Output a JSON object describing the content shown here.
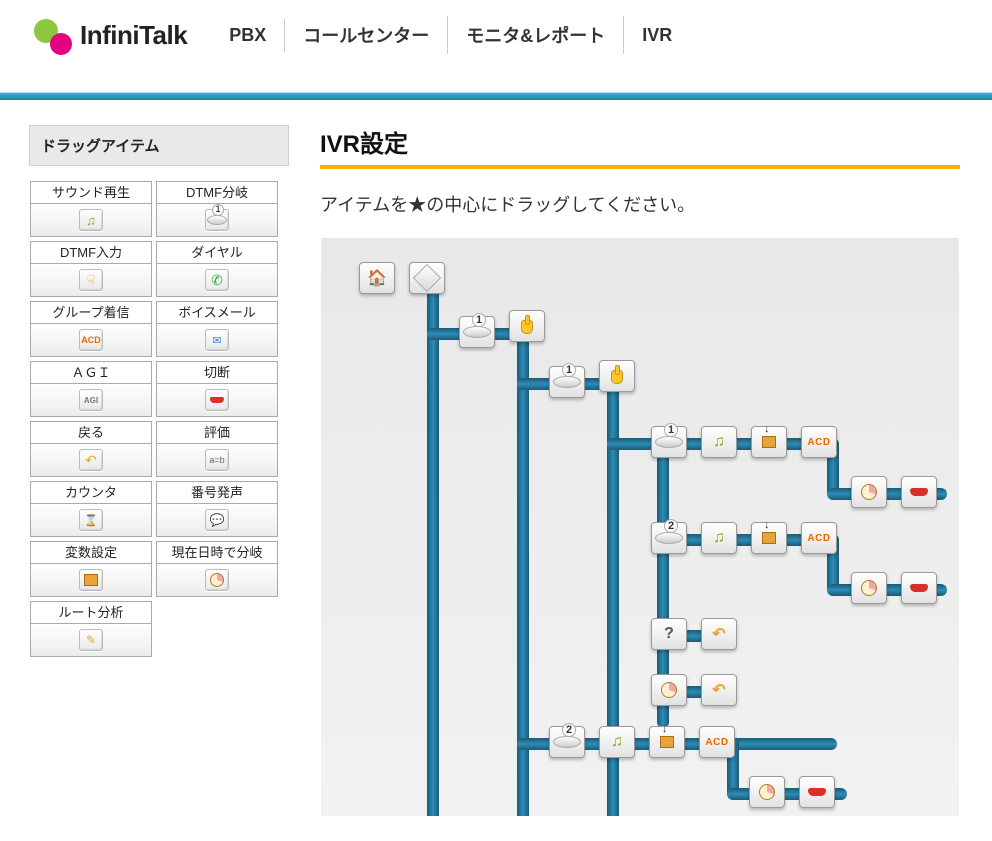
{
  "brand": {
    "name": "InfiniTalk"
  },
  "nav": {
    "pbx": "PBX",
    "callcenter": "コールセンター",
    "monitor": "モニタ&レポート",
    "ivr": "IVR"
  },
  "sidebar": {
    "title": "ドラッグアイテム",
    "items": [
      {
        "label": "サウンド再生",
        "icon": "music"
      },
      {
        "label": "DTMF分岐",
        "icon": "disc"
      },
      {
        "label": "DTMF入力",
        "icon": "hand"
      },
      {
        "label": "ダイヤル",
        "icon": "dial"
      },
      {
        "label": "グループ着信",
        "icon": "acd"
      },
      {
        "label": "ボイスメール",
        "icon": "mail"
      },
      {
        "label": "ＡＧＩ",
        "icon": "agi"
      },
      {
        "label": "切断",
        "icon": "hang"
      },
      {
        "label": "戻る",
        "icon": "back"
      },
      {
        "label": "評価",
        "icon": "eval"
      },
      {
        "label": "カウンタ",
        "icon": "counter"
      },
      {
        "label": "番号発声",
        "icon": "speak"
      },
      {
        "label": "変数設定",
        "icon": "varset"
      },
      {
        "label": "現在日時で分岐",
        "icon": "clock"
      },
      {
        "label": "ルート分析",
        "icon": "route"
      }
    ]
  },
  "page": {
    "title": "IVR設定",
    "instruction": "アイテムを★の中心にドラッグしてください。"
  },
  "flow": {
    "branch_labels": {
      "one": "1",
      "two": "2",
      "q": "?"
    },
    "acd_label": "ACD"
  }
}
